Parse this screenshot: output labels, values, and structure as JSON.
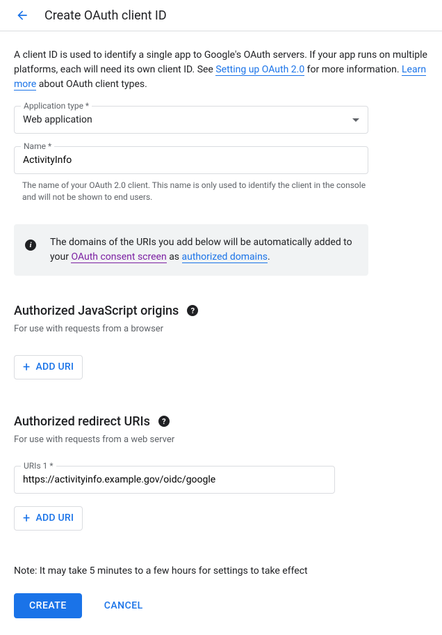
{
  "header": {
    "title": "Create OAuth client ID"
  },
  "intro": {
    "text1": "A client ID is used to identify a single app to Google's OAuth servers. If your app runs on multiple platforms, each will need its own client ID. See ",
    "link1": "Setting up OAuth 2.0",
    "text2": " for more information. ",
    "link2": "Learn more",
    "text3": " about OAuth client types."
  },
  "app_type": {
    "label": "Application type *",
    "value": "Web application"
  },
  "name_field": {
    "label": "Name *",
    "value": "ActivityInfo",
    "helper": "The name of your OAuth 2.0 client. This name is only used to identify the client in the console and will not be shown to end users."
  },
  "info_box": {
    "text1": "The domains of the URIs you add below will be automatically added to your ",
    "link1": "OAuth consent screen",
    "text2": " as ",
    "link2": "authorized domains",
    "text3": "."
  },
  "js_origins": {
    "title": "Authorized JavaScript origins",
    "desc": "For use with requests from a browser",
    "add_btn": "ADD URI"
  },
  "redirect_uris": {
    "title": "Authorized redirect URIs",
    "desc": "For use with requests from a web server",
    "uri1_label": "URIs 1 *",
    "uri1_value": "https://activityinfo.example.gov/oidc/google",
    "add_btn": "ADD URI"
  },
  "note": "Note: It may take 5 minutes to a few hours for settings to take effect",
  "buttons": {
    "create": "CREATE",
    "cancel": "CANCEL"
  }
}
